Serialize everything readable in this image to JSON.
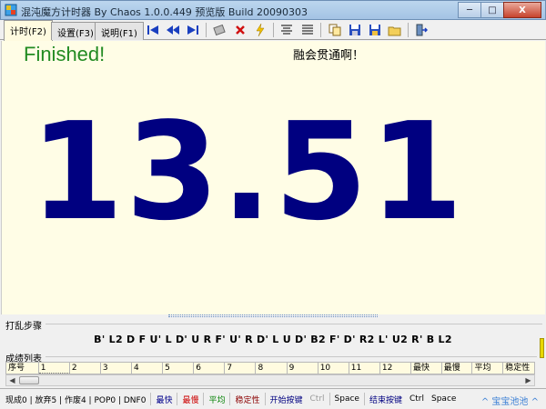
{
  "window": {
    "title": "混沌魔方计时器 By Chaos 1.0.0.449 预览版 Build 20090303",
    "min_label": "─",
    "max_label": "□",
    "close_label": "X"
  },
  "tabs": [
    {
      "label": "计时(F2)",
      "active": true
    },
    {
      "label": "设置(F3)",
      "active": false
    },
    {
      "label": "说明(F1)",
      "active": false
    }
  ],
  "main": {
    "status": "Finished!",
    "motto": "融会贯通啊！",
    "time": "13.51"
  },
  "scramble": {
    "label": "打乱步骤",
    "text": "B' L2 D F U' L D' U R F' U' R D' L U D' B2 F' D' R2 L' U2 R' B L2"
  },
  "results": {
    "label": "成绩列表",
    "headers": [
      "序号",
      "1",
      "2",
      "3",
      "4",
      "5",
      "6",
      "7",
      "8",
      "9",
      "10",
      "11",
      "12",
      "最快",
      "最慢",
      "平均",
      "稳定性"
    ]
  },
  "statusbar": {
    "counts": "现成0 | 放弃5 | 作废4 | POP0 | DNF0",
    "fastest": "最快",
    "slowest": "最慢",
    "average": "平均",
    "stability": "稳定性",
    "start_key_label": "开始按键",
    "start_key_ctrl": "Ctrl",
    "start_key_space": "Space",
    "end_key_label": "结束按键",
    "end_key_ctrl": "Ctrl",
    "end_key_space": "Space",
    "link": "^ 宝宝池池 ^"
  },
  "colors": {
    "timer": "#000080",
    "status": "#228b22",
    "main_bg": "#fffde6"
  }
}
